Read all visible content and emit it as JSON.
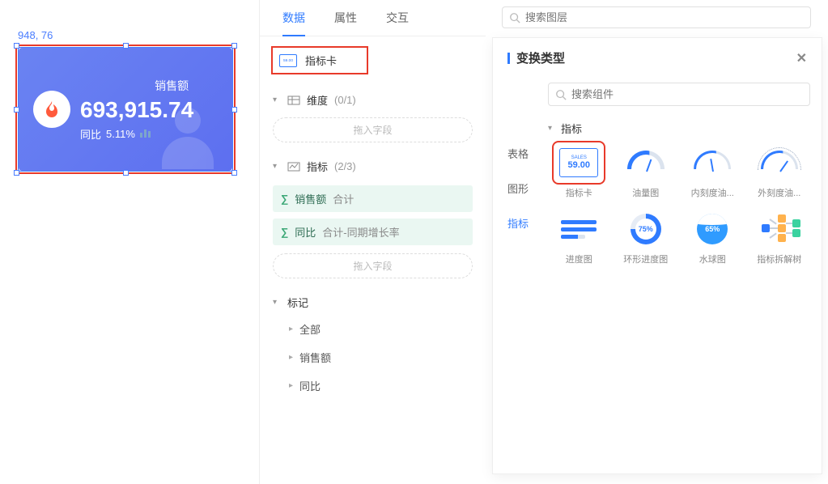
{
  "canvas": {
    "coord_label": "948, 76",
    "card": {
      "title": "销售额",
      "value": "693,915.74",
      "delta_prefix": "同比",
      "delta_value": "5.11%"
    }
  },
  "config": {
    "tabs": {
      "data": "数据",
      "attr": "属性",
      "interact": "交互"
    },
    "chart_type_label": "指标卡",
    "dimension": {
      "label": "维度",
      "count": "(0/1)",
      "placeholder": "拖入字段"
    },
    "metric": {
      "label": "指标",
      "count": "(2/3)",
      "fields": [
        {
          "name": "销售额",
          "agg": "合计"
        },
        {
          "name": "同比",
          "agg": "合计-同期增长率"
        }
      ],
      "placeholder": "拖入字段"
    },
    "marks": {
      "label": "标记",
      "items": [
        "全部",
        "销售额",
        "同比"
      ]
    }
  },
  "searchTop": {
    "placeholder": "搜索图层"
  },
  "modal": {
    "title": "变换类型",
    "search_placeholder": "搜索组件",
    "categories": {
      "table": "表格",
      "shape": "图形",
      "metric": "指标"
    },
    "group_label": "指标",
    "components": {
      "metric_card": {
        "label": "指标卡",
        "sample_title": "SALES",
        "sample_value": "59.00"
      },
      "fuel": {
        "label": "油量图"
      },
      "inner_dial": {
        "label": "内刻度油..."
      },
      "outer_dial": {
        "label": "外刻度油..."
      },
      "progress": {
        "label": "进度图"
      },
      "ring": {
        "label": "环形进度图",
        "pct": "75%"
      },
      "liquid": {
        "label": "水球图",
        "pct": "65%"
      },
      "tree": {
        "label": "指标拆解树"
      }
    }
  }
}
